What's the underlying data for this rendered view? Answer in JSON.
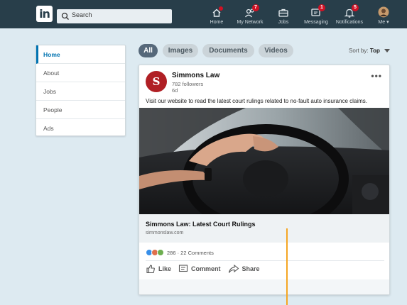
{
  "topbar": {
    "logo_text": "in",
    "search_placeholder": "Search",
    "nav": [
      {
        "key": "home",
        "label": "Home",
        "icon": "home-icon",
        "badge": ""
      },
      {
        "key": "network",
        "label": "My Network",
        "icon": "people-icon",
        "badge": "7"
      },
      {
        "key": "jobs",
        "label": "Jobs",
        "icon": "briefcase-icon",
        "badge": ""
      },
      {
        "key": "messaging",
        "label": "Messaging",
        "icon": "chat-icon",
        "badge": "1"
      },
      {
        "key": "notifications",
        "label": "Notifications",
        "icon": "bell-icon",
        "badge": "5"
      },
      {
        "key": "me",
        "label": "Me",
        "icon": "avatar",
        "badge": ""
      }
    ]
  },
  "sidebar": {
    "items": [
      {
        "label": "Home",
        "active": true
      },
      {
        "label": "About",
        "active": false
      },
      {
        "label": "Jobs",
        "active": false
      },
      {
        "label": "People",
        "active": false
      },
      {
        "label": "Ads",
        "active": false
      }
    ]
  },
  "filters": {
    "chips": [
      "All",
      "Images",
      "Documents",
      "Videos"
    ],
    "active": "All",
    "sort_label": "Sort by:",
    "sort_value": "Top"
  },
  "post": {
    "avatar_letter": "S",
    "author": "Simmons Law",
    "followers": "782 followers",
    "time": "6d",
    "more": "•••",
    "text": "Visit our website to read the latest court rulings related to no-fault auto insurance claims.",
    "link_title": "Simmons Law: Latest Court Rulings",
    "link_url": "simmonslaw.com",
    "reactions_text": "286 · 22 Comments",
    "actions": {
      "like": "Like",
      "comment": "Comment",
      "share": "Share"
    }
  },
  "colors": {
    "nav_bg": "#283e4a",
    "accent": "#0073b1",
    "badge": "#d11124",
    "avatar_brand": "#b01f24",
    "marker": "#f5a623"
  }
}
